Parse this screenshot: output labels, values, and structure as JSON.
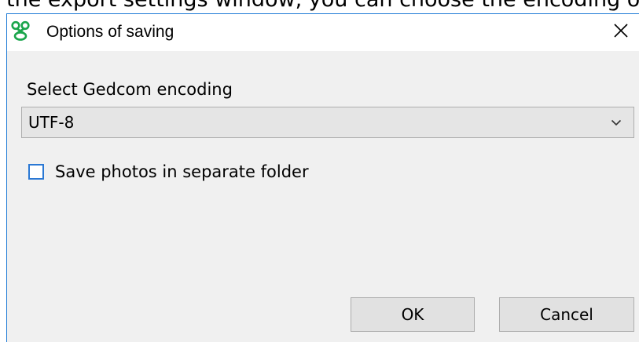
{
  "context": {
    "partial_text": "the export settings window, you can choose the encoding of"
  },
  "dialog": {
    "title": "Options of saving",
    "icon": "app-logo-icon",
    "close_icon": "close-icon",
    "close_glyph": "✕"
  },
  "encoding": {
    "label": "Select Gedcom encoding",
    "selected": "UTF-8",
    "dropdown_icon": "chevron-down-icon"
  },
  "photos_option": {
    "label": "Save photos in separate folder",
    "checked": false
  },
  "buttons": {
    "ok_label": "OK",
    "cancel_label": "Cancel"
  },
  "colors": {
    "window_border": "#1e7bd6",
    "dialog_background": "#f0f0f0",
    "checkbox_border": "#2a78d4",
    "logo_green": "#1aa54b"
  }
}
